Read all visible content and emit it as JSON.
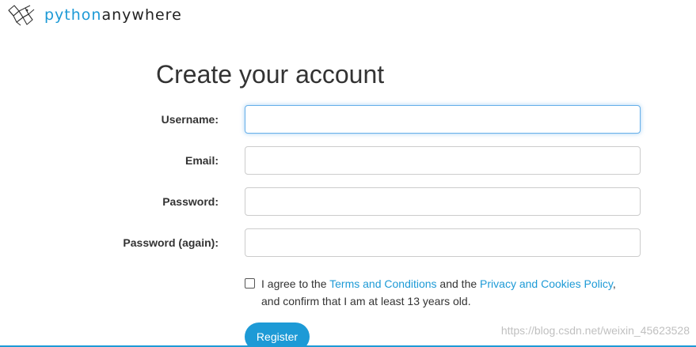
{
  "brand": {
    "part1": "python",
    "part2": "anywhere",
    "icon": "python-anywhere-logo-icon",
    "accent_color": "#1d9ad6"
  },
  "page": {
    "title": "Create your account"
  },
  "form": {
    "fields": [
      {
        "label": "Username:",
        "value": "",
        "state": "focused"
      },
      {
        "label": "Email:",
        "value": ""
      },
      {
        "label": "Password:",
        "value": ""
      },
      {
        "label": "Password (again):",
        "value": ""
      }
    ],
    "agree": {
      "checked": false,
      "prefix": "I agree to the ",
      "terms_link": "Terms and Conditions",
      "middle": " and the ",
      "privacy_link": "Privacy and Cookies Policy",
      "suffix": ",",
      "line2": "and confirm that I am at least 13 years old."
    },
    "register_label": "Register"
  },
  "watermark": "https://blog.csdn.net/weixin_45623528"
}
